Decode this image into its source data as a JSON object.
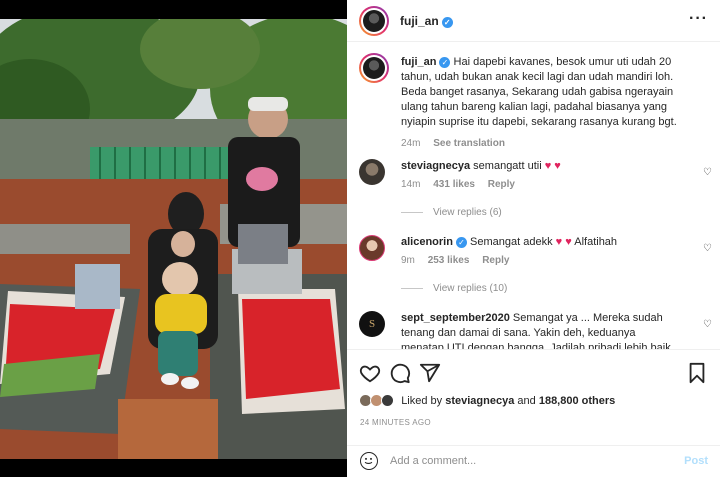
{
  "post": {
    "author": "fuji_an",
    "caption": "Hai dapebi kavanes, besok umur uti udah 20 tahun, udah bukan anak kecil lagi dan udah mandiri loh. Beda banget rasanya, Sekarang udah gabisa ngerayain ulang tahun bareng kalian lagi, padahal biasanya yang nyiapin suprise itu dapebi, sekarang rasanya kurang bgt.",
    "caption_age": "24m",
    "see_translation": "See translation"
  },
  "comments": [
    {
      "user": "steviagnecya",
      "verified": false,
      "text": "semangatt utii",
      "emoji": "♥ ♥",
      "age": "14m",
      "likes": "431 likes",
      "reply": "Reply",
      "view_replies": "View replies (6)"
    },
    {
      "user": "alicenorin",
      "verified": true,
      "text": "Semangat adekk",
      "emoji": "♥ ♥",
      "extra": "Alfatihah",
      "age": "9m",
      "likes": "253 likes",
      "reply": "Reply",
      "view_replies": "View replies (10)"
    },
    {
      "user": "sept_september2020",
      "verified": false,
      "text": "Semangat ya ... Mereka sudah tenang dan damai di sana. Yakin deh, keduanya menatap UTI dengan bangga. Jadilah pribadi lebih baik Dan lebih baik lagi... Doa"
    }
  ],
  "likes": {
    "prefix": "Liked by",
    "user": "steviagnecya",
    "and": "and",
    "count": "188,800 others"
  },
  "timestamp": "24 MINUTES AGO",
  "add_comment": {
    "placeholder": "Add a comment...",
    "post": "Post"
  },
  "icons": [
    "heart-icon",
    "comment-icon",
    "share-icon",
    "bookmark-icon",
    "emoji-icon",
    "more-icon",
    "verified-icon"
  ],
  "colors": {
    "verified": "#3897f0",
    "post_disabled": "#b2dffc",
    "heart": "#e0245e"
  }
}
